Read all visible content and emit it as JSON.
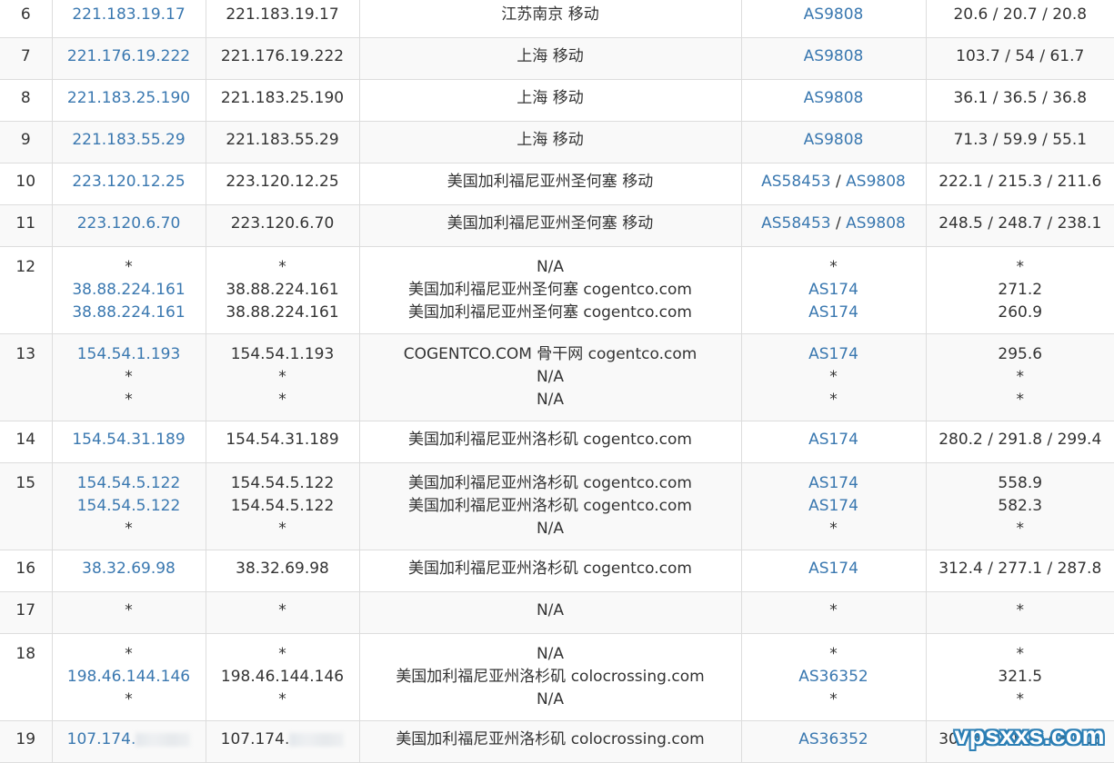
{
  "rows": [
    {
      "hop": "6",
      "ip": [
        "221.183.19.17"
      ],
      "host": [
        "221.183.19.17"
      ],
      "loc": [
        "江苏南京 移动"
      ],
      "asn": [
        [
          "AS9808"
        ]
      ],
      "rtt": [
        "20.6 / 20.7 / 20.8"
      ]
    },
    {
      "hop": "7",
      "ip": [
        "221.176.19.222"
      ],
      "host": [
        "221.176.19.222"
      ],
      "loc": [
        "上海 移动"
      ],
      "asn": [
        [
          "AS9808"
        ]
      ],
      "rtt": [
        "103.7 / 54 / 61.7"
      ]
    },
    {
      "hop": "8",
      "ip": [
        "221.183.25.190"
      ],
      "host": [
        "221.183.25.190"
      ],
      "loc": [
        "上海 移动"
      ],
      "asn": [
        [
          "AS9808"
        ]
      ],
      "rtt": [
        "36.1 / 36.5 / 36.8"
      ]
    },
    {
      "hop": "9",
      "ip": [
        "221.183.55.29"
      ],
      "host": [
        "221.183.55.29"
      ],
      "loc": [
        "上海 移动"
      ],
      "asn": [
        [
          "AS9808"
        ]
      ],
      "rtt": [
        "71.3 / 59.9 / 55.1"
      ]
    },
    {
      "hop": "10",
      "ip": [
        "223.120.12.25"
      ],
      "host": [
        "223.120.12.25"
      ],
      "loc": [
        "美国加利福尼亚州圣何塞 移动"
      ],
      "asn": [
        [
          "AS58453",
          "AS9808"
        ]
      ],
      "rtt": [
        "222.1 / 215.3 / 211.6"
      ]
    },
    {
      "hop": "11",
      "ip": [
        "223.120.6.70"
      ],
      "host": [
        "223.120.6.70"
      ],
      "loc": [
        "美国加利福尼亚州圣何塞 移动"
      ],
      "asn": [
        [
          "AS58453",
          "AS9808"
        ]
      ],
      "rtt": [
        "248.5 / 248.7 / 238.1"
      ]
    },
    {
      "hop": "12",
      "ip": [
        "*",
        "38.88.224.161",
        "38.88.224.161"
      ],
      "host": [
        "*",
        "38.88.224.161",
        "38.88.224.161"
      ],
      "loc": [
        "N/A",
        "美国加利福尼亚州圣何塞 cogentco.com",
        "美国加利福尼亚州圣何塞 cogentco.com"
      ],
      "asn": [
        [
          "*"
        ],
        [
          "AS174"
        ],
        [
          "AS174"
        ]
      ],
      "rtt": [
        "*",
        "271.2",
        "260.9"
      ]
    },
    {
      "hop": "13",
      "ip": [
        "154.54.1.193",
        "*",
        "*"
      ],
      "host": [
        "154.54.1.193",
        "*",
        "*"
      ],
      "loc": [
        "COGENTCO.COM 骨干网 cogentco.com",
        "N/A",
        "N/A"
      ],
      "asn": [
        [
          "AS174"
        ],
        [
          "*"
        ],
        [
          "*"
        ]
      ],
      "rtt": [
        "295.6",
        "*",
        "*"
      ]
    },
    {
      "hop": "14",
      "ip": [
        "154.54.31.189"
      ],
      "host": [
        "154.54.31.189"
      ],
      "loc": [
        "美国加利福尼亚州洛杉矶 cogentco.com"
      ],
      "asn": [
        [
          "AS174"
        ]
      ],
      "rtt": [
        "280.2 / 291.8 / 299.4"
      ]
    },
    {
      "hop": "15",
      "ip": [
        "154.54.5.122",
        "154.54.5.122",
        "*"
      ],
      "host": [
        "154.54.5.122",
        "154.54.5.122",
        "*"
      ],
      "loc": [
        "美国加利福尼亚州洛杉矶 cogentco.com",
        "美国加利福尼亚州洛杉矶 cogentco.com",
        "N/A"
      ],
      "asn": [
        [
          "AS174"
        ],
        [
          "AS174"
        ],
        [
          "*"
        ]
      ],
      "rtt": [
        "558.9",
        "582.3",
        "*"
      ]
    },
    {
      "hop": "16",
      "ip": [
        "38.32.69.98"
      ],
      "host": [
        "38.32.69.98"
      ],
      "loc": [
        "美国加利福尼亚州洛杉矶 cogentco.com"
      ],
      "asn": [
        [
          "AS174"
        ]
      ],
      "rtt": [
        "312.4 / 277.1 / 287.8"
      ]
    },
    {
      "hop": "17",
      "ip": [
        "*"
      ],
      "host": [
        "*"
      ],
      "loc": [
        "N/A"
      ],
      "asn": [
        [
          "*"
        ]
      ],
      "rtt": [
        "*"
      ]
    },
    {
      "hop": "18",
      "ip": [
        "*",
        "198.46.144.146",
        "*"
      ],
      "host": [
        "*",
        "198.46.144.146",
        "*"
      ],
      "loc": [
        "N/A",
        "美国加利福尼亚州洛杉矶 colocrossing.com",
        "N/A"
      ],
      "asn": [
        [
          "*"
        ],
        [
          "AS36352"
        ],
        [
          "*"
        ]
      ],
      "rtt": [
        "*",
        "321.5",
        "*"
      ]
    },
    {
      "hop": "19",
      "ip": [
        "107.174."
      ],
      "host": [
        "107.174."
      ],
      "loc": [
        "美国加利福尼亚州洛杉矶 colocrossing.com"
      ],
      "asn": [
        [
          "AS36352"
        ]
      ],
      "rtt": [
        "304.5 / 306.6 / 304.3"
      ],
      "redacted": true
    }
  ],
  "watermark": "vpsxxs.com",
  "colors": {
    "link": "#3a78b0",
    "text": "#333333",
    "border": "#dddddd",
    "stripe": "#f9f9f9",
    "watermark": "#2c7fb5"
  }
}
